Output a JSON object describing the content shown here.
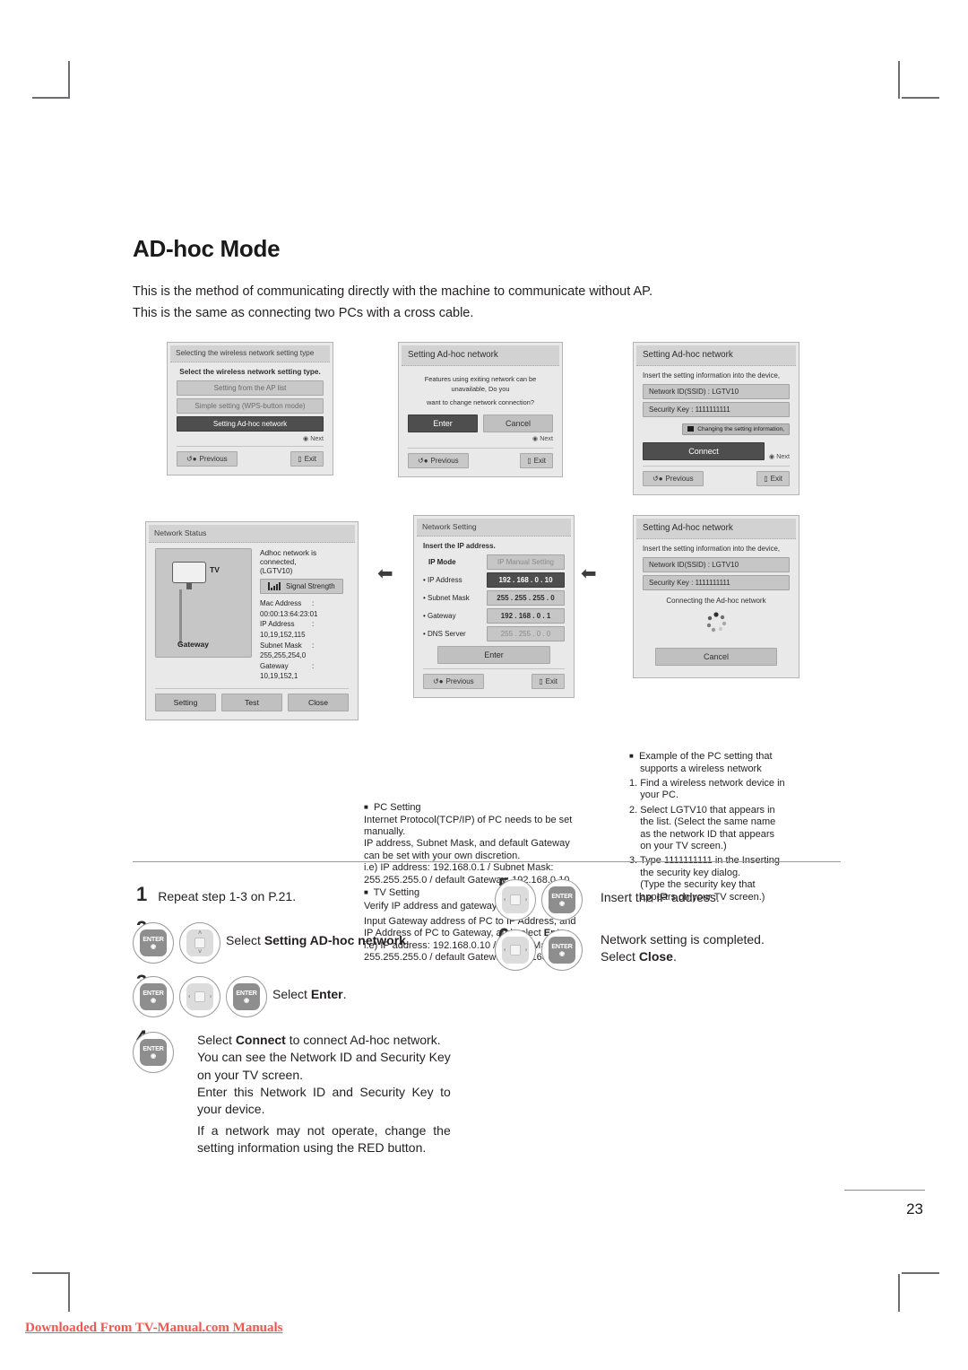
{
  "page": {
    "title": "AD-hoc Mode",
    "intro_line1": "This is the method of communicating directly with the machine to communicate without AP.",
    "intro_line2": "This is the same as connecting two PCs with a cross cable.",
    "page_number": "23",
    "footer": "Downloaded From TV-Manual.com Manuals"
  },
  "screens": {
    "select_type": {
      "header": "Selecting the wireless network setting type",
      "lead": "Select the wireless network setting type.",
      "options": [
        "Setting from the AP list",
        "Simple setting (WPS-button mode)",
        "Setting Ad-hoc network"
      ],
      "next": "Next",
      "previous": "Previous",
      "exit": "Exit"
    },
    "confirm": {
      "header": "Setting Ad-hoc network",
      "message_line1": "Features using exiting network can be unavailable, Do you",
      "message_line2": "want to change network connection?",
      "enter": "Enter",
      "cancel": "Cancel",
      "next": "Next",
      "previous": "Previous",
      "exit": "Exit"
    },
    "insert_info": {
      "header": "Setting Ad-hoc network",
      "lead": "Insert the setting information into the device,",
      "network_id": "Network ID(SSID) : LGTV10",
      "security_key": "Security Key : 1111111111",
      "red_tag": "Changing the setting information,",
      "connect": "Connect",
      "next": "Next",
      "previous": "Previous",
      "exit": "Exit"
    },
    "connecting": {
      "header": "Setting Ad-hoc network",
      "lead": "Insert the setting information into the device,",
      "network_id": "Network ID(SSID) : LGTV10",
      "security_key": "Security Key : 1111111111",
      "status": "Connecting the Ad-hoc network",
      "cancel": "Cancel"
    },
    "network_setting": {
      "header": "Network Setting",
      "lead": "Insert the IP address.",
      "rows": [
        {
          "label": "IP Mode",
          "value": "IP Manual Setting"
        },
        {
          "label": "• IP Address",
          "value": "192 . 168 . 0 . 10"
        },
        {
          "label": "• Subnet Mask",
          "value": "255 . 255 . 255 . 0"
        },
        {
          "label": "• Gateway",
          "value": "192 . 168 . 0 . 1"
        },
        {
          "label": "• DNS Server",
          "value": "255 . 255 . 0 . 0"
        }
      ],
      "enter": "Enter",
      "previous": "Previous",
      "exit": "Exit"
    },
    "network_status": {
      "header": "Network Status",
      "tv_label": "TV",
      "gateway_label": "Gateway",
      "connected_line1": "Adhoc network is connected,",
      "connected_line2": "(LGTV10)",
      "signal_strength": "Signal Strength",
      "info": [
        {
          "label": "Mac Address",
          "value": ": 00:00:13:64:23:01"
        },
        {
          "label": "IP Address",
          "value": ": 10,19,152,115"
        },
        {
          "label": "Subnet Mask",
          "value": ": 255,255,254,0"
        },
        {
          "label": "Gateway",
          "value": ": 10,19,152,1"
        }
      ],
      "setting": "Setting",
      "test": "Test",
      "close": "Close"
    }
  },
  "captions": {
    "pc_setting": {
      "heading": "PC Setting",
      "lines": [
        "Internet Protocol(TCP/IP) of PC needs to be set",
        "manually.",
        "IP address, Subnet Mask, and default Gateway",
        "can be set with your own discretion.",
        "i.e) IP address: 192.168.0.1 / Subnet Mask:",
        "255.255.255.0 / default Gateway: 192.168.0.10"
      ]
    },
    "tv_setting": {
      "heading": "TV Setting",
      "line1": "Verify IP address and gateway of PC.",
      "line2a": "Input Gateway address of PC to IP Address, and",
      "line2b": "IP Address of PC to Gateway, and select ",
      "line2_bold": "Enter",
      "line2_end": ".",
      "line3": "i.e) IP address: 192.168.0.10 / Subnet Mask:",
      "line4": "255.255.255.0 / default Gateway: 192.168.0.1"
    },
    "pc_example": {
      "heading_line1": "Example of the PC setting that",
      "heading_line2": "supports a wireless network",
      "items": [
        "1. Find a wireless network device in",
        "    your PC.",
        "2. Select LGTV10 that appears in",
        "    the list. (Select the same name",
        "    as the network ID that appears",
        "    on your TV screen.)",
        "3. Type 1111111111 in the Inserting",
        "    the security key dialog.",
        "    (Type the security key that",
        "    appears on your TV screen.)"
      ]
    }
  },
  "steps": {
    "s1": {
      "num": "1",
      "text": "Repeat step 1-3 on P.21."
    },
    "s2": {
      "num": "2",
      "text_pre": "Select ",
      "text_bold": "Setting AD-hoc network",
      "text_post": "."
    },
    "s3": {
      "num": "3",
      "text_pre": "Select ",
      "text_bold": "Enter",
      "text_post": "."
    },
    "s4": {
      "num": "4",
      "l1_pre": "Select ",
      "l1_bold": "Connect",
      "l1_post": " to connect Ad-hoc network.",
      "l2": "You can see the Network ID and Security Key",
      "l3": "on your TV screen.",
      "l4": "Enter this Network ID and Security Key to",
      "l5": "your device.",
      "l6": "If a network may not operate, change the",
      "l7": "setting information using the RED button."
    },
    "s5": {
      "num": "5",
      "text": "Insert the IP address."
    },
    "s6": {
      "num": "6",
      "l1": "Network setting is completed.",
      "l2_pre": "Select ",
      "l2_bold": "Close",
      "l2_post": "."
    }
  },
  "key_labels": {
    "enter": "ENTER",
    "left": "‹",
    "right": "›",
    "up": "˄",
    "down": "˅"
  }
}
